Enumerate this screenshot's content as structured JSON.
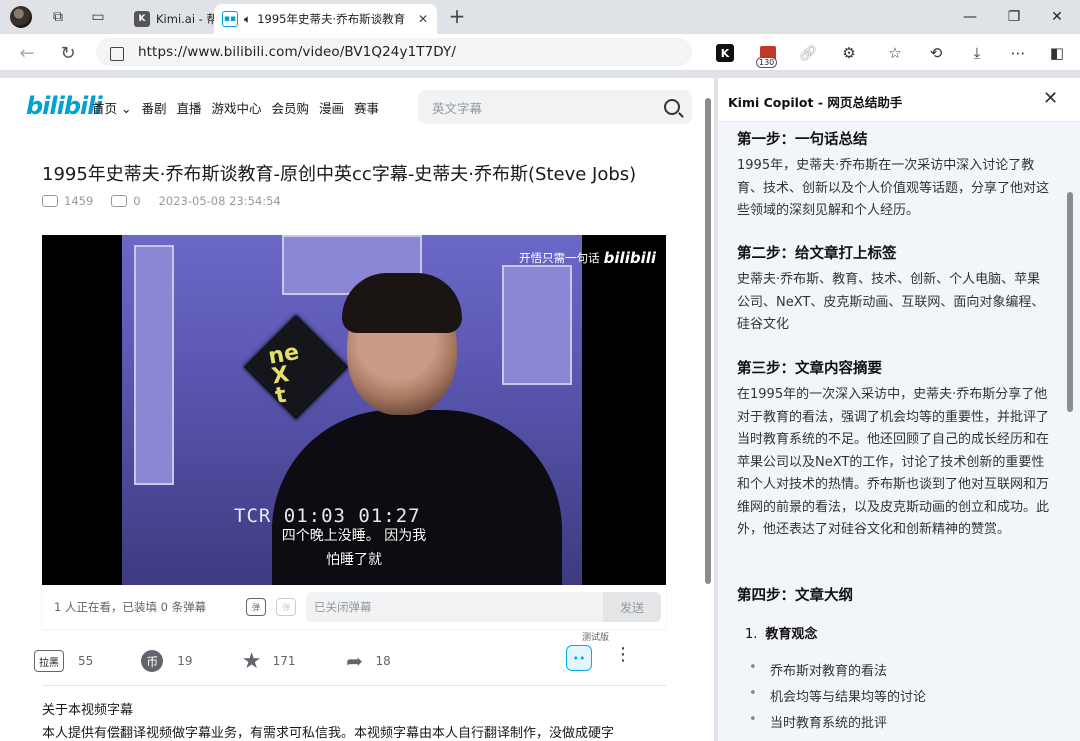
{
  "browser": {
    "tabs": [
      {
        "label": "Kimi.ai - 帮"
      },
      {
        "label": "1995年史蒂夫·乔布斯谈教育"
      }
    ],
    "url": "https://www.bilibili.com/video/BV1Q24y1T7DY/",
    "notification_count": "130"
  },
  "bilibili": {
    "logo": "bilibili",
    "nav": [
      "首页",
      "番剧",
      "直播",
      "游戏中心",
      "会员购",
      "漫画",
      "赛事"
    ],
    "search_placeholder": "英文字幕",
    "video": {
      "title": "1995年史蒂夫·乔布斯谈教育-原创中英cc字幕-史蒂夫·乔布斯(Steve Jobs)",
      "views": "1459",
      "danmaku": "0",
      "date": "2023-05-08 23:54:54",
      "watermark": "开悟只需一句话",
      "timecode": "TCR 01:03 01:27",
      "subtitle_line1": "四个晚上没睡。 因为我",
      "subtitle_line2": "怕睡了就"
    },
    "danmaku_bar": {
      "count_text": "1 人正在看，已装填 0 条弹幕",
      "input_placeholder": "已关闭弹幕",
      "send_label": "发送"
    },
    "actions": {
      "block_label": "拉黑",
      "like": "55",
      "coin": "19",
      "favorite": "171",
      "share": "18",
      "ai_tag": "测试版"
    },
    "description": {
      "title": "关于本视频字幕",
      "text": "本人提供有偿翻译视频做字幕业务，有需求可私信我。本视频字幕由本人自行翻译制作，没做成硬字"
    }
  },
  "kimi": {
    "title": "Kimi Copilot - 网页总结助手",
    "step1": {
      "heading": "第一步：一句话总结",
      "text": "1995年，史蒂夫·乔布斯在一次采访中深入讨论了教育、技术、创新以及个人价值观等话题，分享了他对这些领域的深刻见解和个人经历。"
    },
    "step2": {
      "heading": "第二步：给文章打上标签",
      "text": "史蒂夫·乔布斯、教育、技术、创新、个人电脑、苹果公司、NeXT、皮克斯动画、互联网、面向对象编程、硅谷文化"
    },
    "step3": {
      "heading": "第三步：文章内容摘要",
      "text": "在1995年的一次深入采访中，史蒂夫·乔布斯分享了他对于教育的看法，强调了机会均等的重要性，并批评了当时教育系统的不足。他还回顾了自己的成长经历和在苹果公司以及NeXT的工作，讨论了技术创新的重要性和个人对技术的热情。乔布斯也谈到了他对互联网和万维网的前景的看法，以及皮克斯动画的创立和成功。此外，他还表达了对硅谷文化和创新精神的赞赏。"
    },
    "step4": {
      "heading": "第四步：文章大纲",
      "outline_num": "1.",
      "outline_title": "教育观念",
      "items": [
        "乔布斯对教育的看法",
        "机会均等与结果均等的讨论",
        "当时教育系统的批评"
      ]
    }
  }
}
